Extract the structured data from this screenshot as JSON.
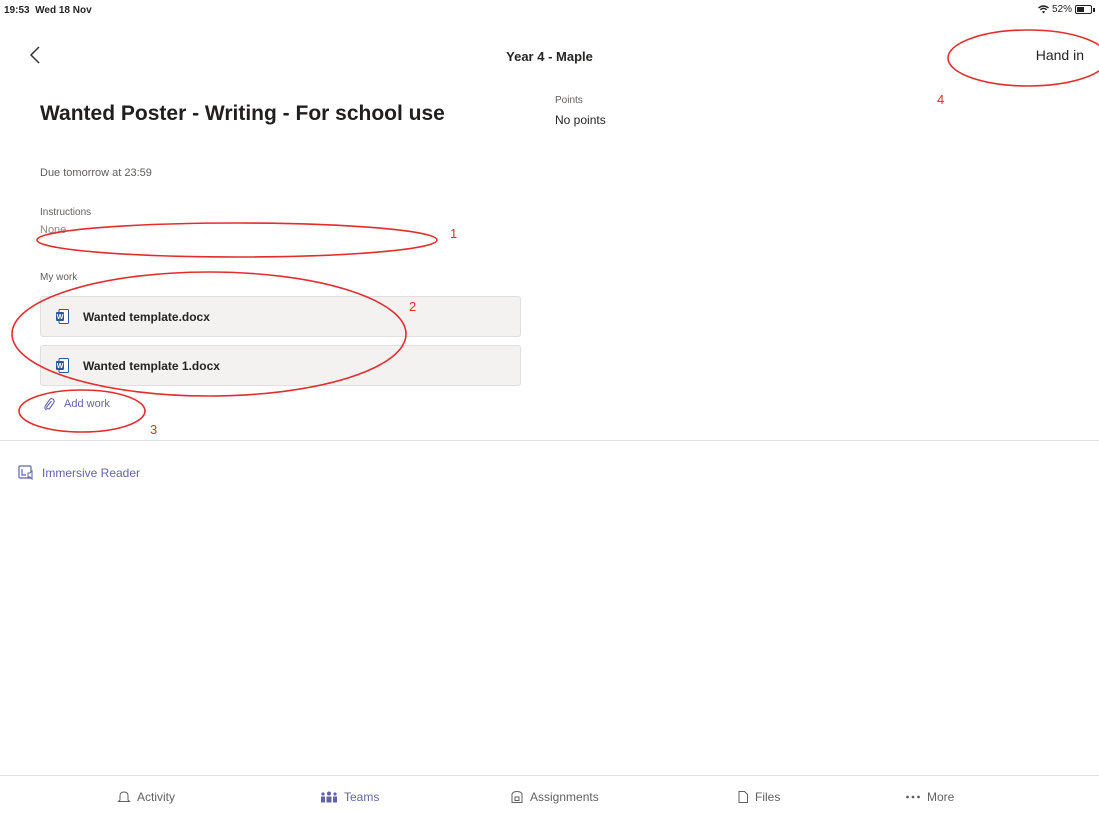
{
  "status_bar": {
    "time": "19:53",
    "date": "Wed 18 Nov",
    "battery": "52%",
    "battery_level": 0.52
  },
  "nav": {
    "title": "Year 4 - Maple",
    "hand_in_label": "Hand in"
  },
  "assignment": {
    "title": "Wanted Poster - Writing - For school use",
    "due": "Due tomorrow at 23:59",
    "points_label": "Points",
    "points_value": "No points",
    "instructions_label": "Instructions",
    "instructions_value": "None",
    "my_work_label": "My work",
    "files": [
      {
        "name": "Wanted template.docx",
        "icon": "word-doc-icon"
      },
      {
        "name": "Wanted template 1.docx",
        "icon": "word-doc-icon"
      }
    ],
    "add_work_label": "Add work"
  },
  "immersive_reader_label": "Immersive Reader",
  "tabs": [
    {
      "label": "Activity",
      "icon": "bell-icon",
      "active": false
    },
    {
      "label": "Teams",
      "icon": "teams-icon",
      "active": true
    },
    {
      "label": "Assignments",
      "icon": "assignments-icon",
      "active": false
    },
    {
      "label": "Files",
      "icon": "file-icon",
      "active": false
    },
    {
      "label": "More",
      "icon": "ellipsis-icon",
      "active": false
    }
  ],
  "annotations": {
    "color": "#e32d2d",
    "numbers": [
      "1",
      "2",
      "3",
      "4"
    ]
  },
  "colors": {
    "accent": "#6264a7",
    "word_blue": "#2b579a"
  }
}
